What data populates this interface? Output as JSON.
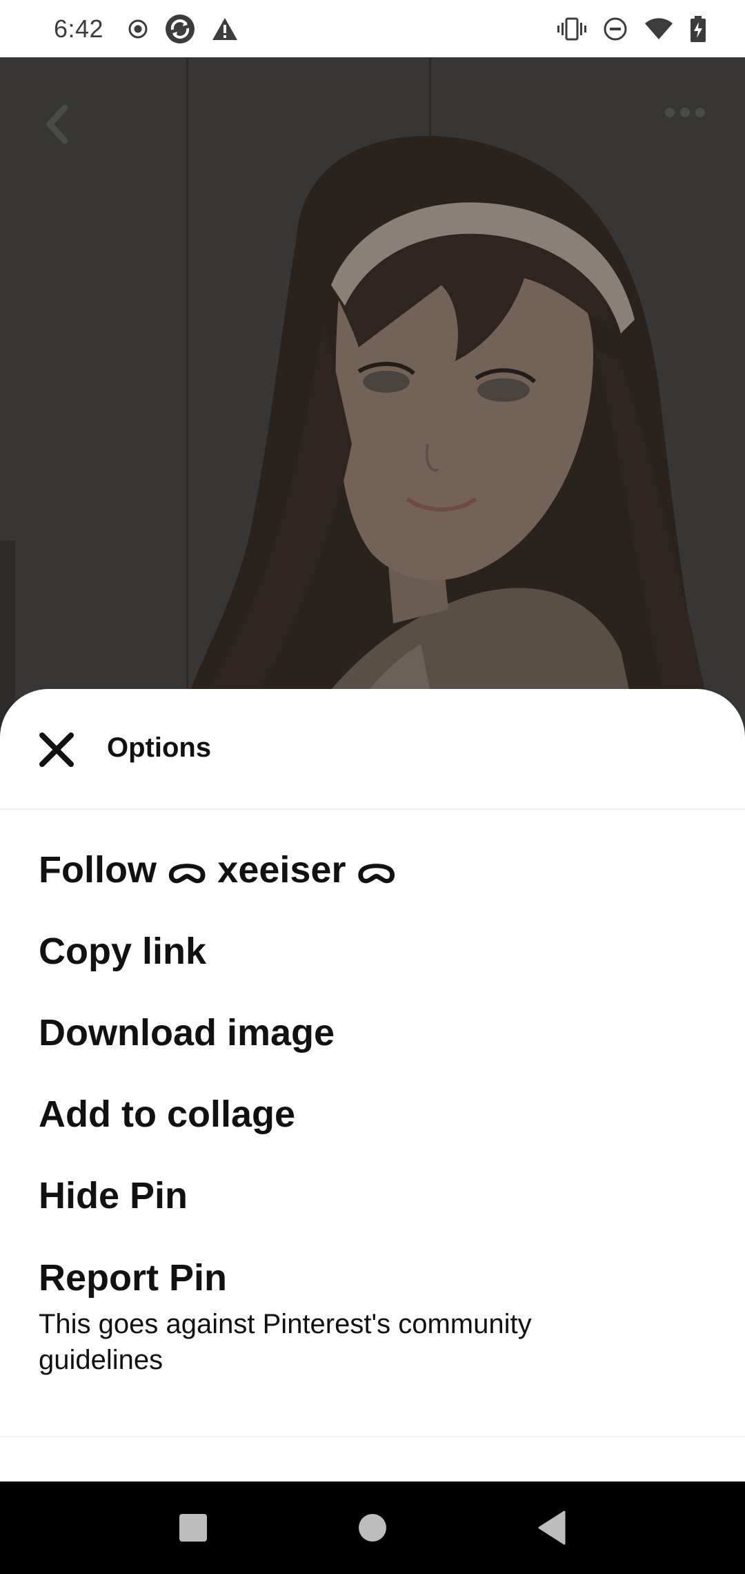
{
  "status_bar": {
    "time": "6:42",
    "left_icons": [
      "record-icon",
      "sync-app-icon",
      "warning-icon"
    ],
    "right_icons": [
      "vibrate-icon",
      "do-not-disturb-icon",
      "wifi-icon",
      "battery-charging-icon"
    ]
  },
  "pin": {
    "back_icon": "chevron-left-icon",
    "more_icon": "more-horizontal-icon"
  },
  "sheet": {
    "title": "Options",
    "close_icon": "close-icon",
    "options": [
      {
        "label": "Follow ᯅ xeeiser ᯅ"
      },
      {
        "label": "Copy link"
      },
      {
        "label": "Download image"
      },
      {
        "label": "Add to collage"
      },
      {
        "label": "Hide Pin"
      },
      {
        "label": "Report Pin",
        "sublabel": "This goes against Pinterest's community guidelines"
      }
    ]
  },
  "nav_bar": {
    "icons": [
      "recents-icon",
      "home-icon",
      "back-icon"
    ]
  },
  "colors": {
    "sheet_bg": "#ffffff",
    "text": "#111111",
    "scrim": "#353431"
  }
}
